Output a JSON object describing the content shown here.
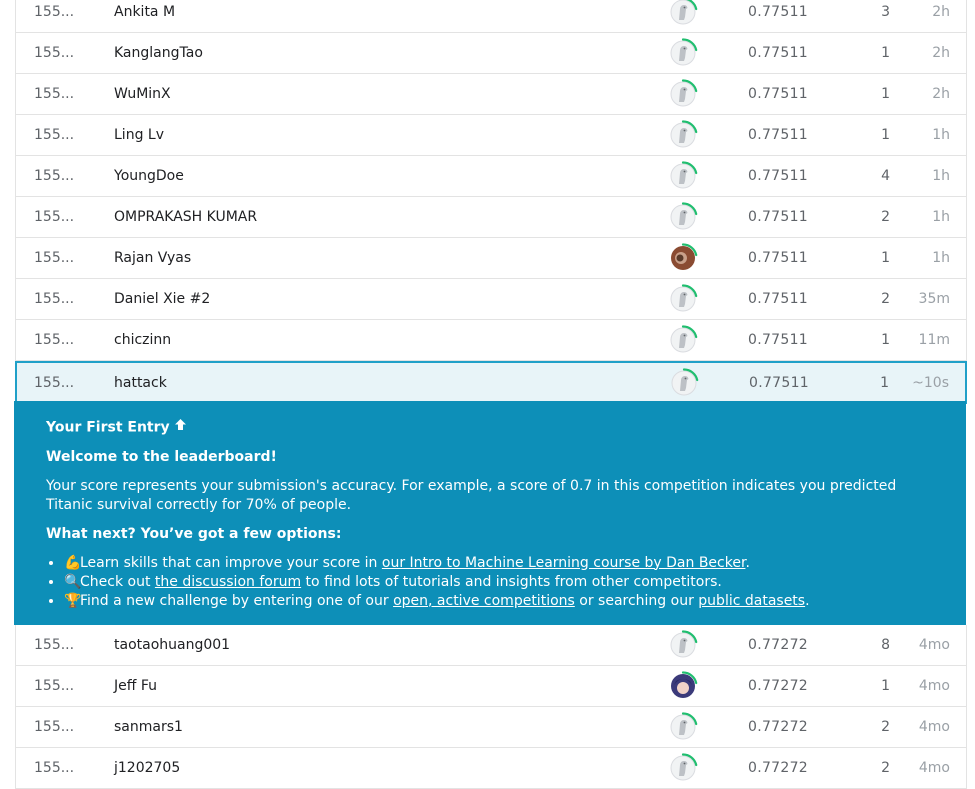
{
  "rows_top": [
    {
      "rank": "155...",
      "name": "Ankita M",
      "avatar": "default",
      "score": "0.77511",
      "entries": "3",
      "last": "2h"
    },
    {
      "rank": "155...",
      "name": "KanglangTao",
      "avatar": "default",
      "score": "0.77511",
      "entries": "1",
      "last": "2h"
    },
    {
      "rank": "155...",
      "name": "WuMinX",
      "avatar": "default",
      "score": "0.77511",
      "entries": "1",
      "last": "2h"
    },
    {
      "rank": "155...",
      "name": "Ling Lv",
      "avatar": "default",
      "score": "0.77511",
      "entries": "1",
      "last": "1h"
    },
    {
      "rank": "155...",
      "name": "YoungDoe",
      "avatar": "default",
      "score": "0.77511",
      "entries": "4",
      "last": "1h"
    },
    {
      "rank": "155...",
      "name": "OMPRAKASH KUMAR",
      "avatar": "default",
      "score": "0.77511",
      "entries": "2",
      "last": "1h"
    },
    {
      "rank": "155...",
      "name": "Rajan Vyas",
      "avatar": "photo",
      "score": "0.77511",
      "entries": "1",
      "last": "1h"
    },
    {
      "rank": "155...",
      "name": "Daniel Xie #2",
      "avatar": "default",
      "score": "0.77511",
      "entries": "2",
      "last": "35m"
    },
    {
      "rank": "155...",
      "name": "chiczinn",
      "avatar": "default",
      "score": "0.77511",
      "entries": "1",
      "last": "11m"
    }
  ],
  "my_row": {
    "rank": "155...",
    "name": "hattack",
    "avatar": "default",
    "score": "0.77511",
    "entries": "1",
    "last": "~10s"
  },
  "panel": {
    "heading": "Your First Entry",
    "welcome": "Welcome to the leaderboard!",
    "explanation": "Your score represents your submission's accuracy. For example, a score of 0.7 in this competition indicates you predicted Titanic survival correctly for 70% of people.",
    "next": "What next? You’ve got a few options:",
    "option1": {
      "emoji": "💪",
      "before": "Learn skills that can improve your score in ",
      "link": "our Intro to Machine Learning course by Dan Becker",
      "after": "."
    },
    "option2": {
      "emoji": "🔍",
      "before": "Check out ",
      "link": "the discussion forum",
      "after": " to find lots of tutorials and insights from other competitors."
    },
    "option3": {
      "emoji": "🏆",
      "before": "Find a new challenge by entering one of our ",
      "link": "open, active competitions",
      "middle": " or searching our ",
      "link2": "public datasets",
      "after": "."
    }
  },
  "rows_bottom": [
    {
      "rank": "155...",
      "name": "taotaohuang001",
      "avatar": "default",
      "score": "0.77272",
      "entries": "8",
      "last": "4mo"
    },
    {
      "rank": "155...",
      "name": "Jeff Fu",
      "avatar": "anime",
      "score": "0.77272",
      "entries": "1",
      "last": "4mo"
    },
    {
      "rank": "155...",
      "name": "sanmars1",
      "avatar": "default",
      "score": "0.77272",
      "entries": "2",
      "last": "4mo"
    },
    {
      "rank": "155...",
      "name": "j1202705",
      "avatar": "default",
      "score": "0.77272",
      "entries": "2",
      "last": "4mo"
    }
  ],
  "colors": {
    "accent": "#20a0c8",
    "panel": "#0d8fb8",
    "progress": "#20be6f"
  }
}
